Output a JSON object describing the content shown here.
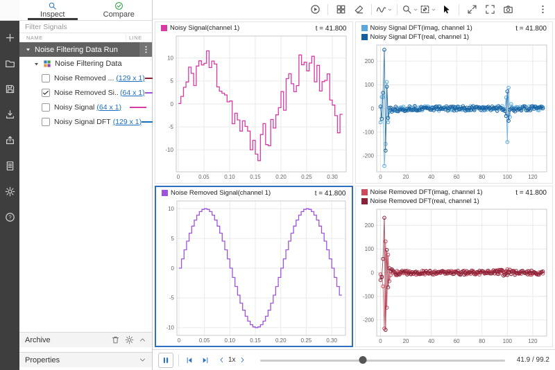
{
  "sidebar": {
    "tabs": [
      {
        "label": "Inspect"
      },
      {
        "label": "Compare"
      }
    ],
    "filter_placeholder": "Filter Signals",
    "columns": {
      "name": "NAME",
      "line": "LINE"
    },
    "run_title": "Noise Filtering Data Run",
    "group_title": "Noise Filtering Data",
    "signals": [
      {
        "name": "Noise Removed ...",
        "dims": "(129 x 1)",
        "checked": false,
        "color": "#8a2136"
      },
      {
        "name": "Noise Removed Si...",
        "dims": "(64 x 1)",
        "checked": true,
        "color": "#9d53dd"
      },
      {
        "name": "Noisy Signal ",
        "dims": "(64 x 1)",
        "checked": false,
        "color": "#d93aa2"
      },
      {
        "name": "Noisy Signal DFT ",
        "dims": "(129 x 1)",
        "checked": false,
        "color": "#1a70b8"
      }
    ],
    "archive_label": "Archive",
    "properties_label": "Properties"
  },
  "left_toolbar": {
    "items": [
      {
        "icon": "plus",
        "name": "add-button"
      },
      {
        "icon": "folder",
        "name": "open-button"
      },
      {
        "icon": "save",
        "name": "save-button"
      },
      {
        "icon": "import",
        "name": "import-button"
      },
      {
        "icon": "export",
        "name": "export-button"
      },
      {
        "icon": "report",
        "name": "report-button"
      },
      {
        "icon": "gear",
        "name": "preferences-button"
      },
      {
        "icon": "help",
        "name": "help-button"
      }
    ]
  },
  "toolbar": {
    "items": [
      {
        "icon": "run-circle",
        "name": "step-run-button"
      },
      {
        "sep": true
      },
      {
        "icon": "grid",
        "name": "subplot-layout-button"
      },
      {
        "icon": "eraser",
        "name": "clear-plots-button"
      },
      {
        "sep": true
      },
      {
        "icon": "wave",
        "name": "signal-style-button",
        "caret": true
      },
      {
        "sep": true
      },
      {
        "icon": "zoom",
        "name": "zoom-button",
        "caret": true
      },
      {
        "icon": "fit",
        "name": "fit-to-view-button",
        "caret": true
      },
      {
        "icon": "pointer",
        "name": "pointer-button",
        "active": true
      },
      {
        "sep": true
      },
      {
        "icon": "expand",
        "name": "expand-button"
      },
      {
        "icon": "fullscreen",
        "name": "fullscreen-button"
      },
      {
        "icon": "camera",
        "name": "snapshot-button"
      },
      {
        "space": true
      },
      {
        "icon": "kebab",
        "name": "more-menu-button"
      }
    ]
  },
  "charts": [
    {
      "id": "noisy-signal",
      "selected": false,
      "type": "stairs",
      "time_label": "t = 41.800",
      "legend": [
        {
          "label": "Noisy Signal(channel 1)",
          "color": "#d93aa2"
        }
      ],
      "axes": {
        "xlim": [
          -0.004,
          0.327
        ],
        "ylim": [
          -14.8,
          14.8
        ],
        "x_ticks": [
          {
            "v": 0,
            "label": "0"
          },
          {
            "v": 0.05,
            "label": "0.05"
          },
          {
            "v": 0.1,
            "label": "0.10"
          },
          {
            "v": 0.15,
            "label": "0.15"
          },
          {
            "v": 0.2,
            "label": "0.20"
          },
          {
            "v": 0.25,
            "label": "0.25"
          },
          {
            "v": 0.3,
            "label": "0.30"
          }
        ],
        "y_ticks": [
          {
            "v": 10,
            "label": "10"
          },
          {
            "v": 5,
            "label": "5"
          },
          {
            "v": 0,
            "label": "0"
          },
          {
            "v": -5,
            "label": "-5"
          },
          {
            "v": -10,
            "label": "-10"
          }
        ]
      },
      "series": [
        {
          "color": "#d93aa2",
          "gen": {
            "kind": "sine_stairs",
            "n": 64,
            "dt": 0.005,
            "freq": 5,
            "amp": 9,
            "noise": 3.9,
            "seed": 11
          }
        }
      ]
    },
    {
      "id": "noisy-dft",
      "selected": false,
      "type": "linemarkers",
      "time_label": "t = 41.800",
      "legend": [
        {
          "label": "Noisy Signal DFT(imag, channel 1)",
          "color": "#5ba7dd"
        },
        {
          "label": "Noisy Signal DFT(real, channel 1)",
          "color": "#145f9e"
        }
      ],
      "axes": {
        "xlim": [
          -3,
          131
        ],
        "ylim": [
          -268,
          268
        ],
        "x_ticks": [
          {
            "v": 0,
            "label": "0"
          },
          {
            "v": 20,
            "label": "20"
          },
          {
            "v": 40,
            "label": "40"
          },
          {
            "v": 60,
            "label": "60"
          },
          {
            "v": 80,
            "label": "80"
          },
          {
            "v": 100,
            "label": "100"
          },
          {
            "v": 120,
            "label": "120"
          }
        ],
        "y_ticks": [
          {
            "v": 200,
            "label": "200"
          },
          {
            "v": 100,
            "label": "100"
          },
          {
            "v": 0,
            "label": "0"
          },
          {
            "v": -100,
            "label": "-100"
          },
          {
            "v": -200,
            "label": "-200"
          }
        ]
      },
      "series": [
        {
          "color": "#5ba7dd",
          "gen": {
            "kind": "dft",
            "n": 129,
            "seed": 7,
            "noise": 10,
            "decay": 5,
            "bump": 16,
            "bump_k": 100,
            "spikes": {
              "2": 48,
              "3": -243,
              "4": -150,
              "5": 112,
              "6": -58,
              "99": 46,
              "100": -142,
              "101": 88,
              "102": -36
            }
          }
        },
        {
          "color": "#145f9e",
          "gen": {
            "kind": "dft",
            "n": 129,
            "seed": 13,
            "noise": 10,
            "decay": 5,
            "bump": 14,
            "bump_k": 100,
            "spikes": {
              "2": 66,
              "3": 248,
              "4": -178,
              "5": 92,
              "6": -40,
              "99": -32,
              "100": 72,
              "101": -52
            }
          }
        }
      ]
    },
    {
      "id": "noise-removed-signal",
      "selected": true,
      "type": "stairs",
      "time_label": "t = 41.800",
      "legend": [
        {
          "label": "Noise Removed Signal(channel 1)",
          "color": "#9d53dd"
        }
      ],
      "axes": {
        "xlim": [
          -0.004,
          0.327
        ],
        "ylim": [
          -11.3,
          11.3
        ],
        "x_ticks": [
          {
            "v": 0,
            "label": "0"
          },
          {
            "v": 0.05,
            "label": "0.05"
          },
          {
            "v": 0.1,
            "label": "0.10"
          },
          {
            "v": 0.15,
            "label": "0.15"
          },
          {
            "v": 0.2,
            "label": "0.20"
          },
          {
            "v": 0.25,
            "label": "0.25"
          },
          {
            "v": 0.3,
            "label": "0.30"
          }
        ],
        "y_ticks": [
          {
            "v": 10,
            "label": "10"
          },
          {
            "v": 5,
            "label": "5"
          },
          {
            "v": 0,
            "label": "0"
          },
          {
            "v": -5,
            "label": "-5"
          },
          {
            "v": -10,
            "label": "-10"
          }
        ]
      },
      "series": [
        {
          "color": "#9d53dd",
          "gen": {
            "kind": "sine_stairs",
            "n": 64,
            "dt": 0.005,
            "freq": 5,
            "amp": 10,
            "noise": 0,
            "seed": 1
          }
        }
      ]
    },
    {
      "id": "noise-removed-dft",
      "selected": false,
      "type": "linemarkers",
      "time_label": "t = 41.800",
      "legend": [
        {
          "label": "Noise Removed DFT(imag, channel 1)",
          "color": "#ce4a5c"
        },
        {
          "label": "Noise Removed DFT(real, channel 1)",
          "color": "#8a2136"
        }
      ],
      "axes": {
        "xlim": [
          -3,
          131
        ],
        "ylim": [
          -268,
          268
        ],
        "x_ticks": [
          {
            "v": 0,
            "label": "0"
          },
          {
            "v": 20,
            "label": "20"
          },
          {
            "v": 40,
            "label": "40"
          },
          {
            "v": 60,
            "label": "60"
          },
          {
            "v": 80,
            "label": "80"
          },
          {
            "v": 100,
            "label": "100"
          },
          {
            "v": 120,
            "label": "120"
          }
        ],
        "y_ticks": [
          {
            "v": 200,
            "label": "200"
          },
          {
            "v": 100,
            "label": "100"
          },
          {
            "v": 0,
            "label": "0"
          },
          {
            "v": -100,
            "label": "-100"
          },
          {
            "v": -200,
            "label": "-200"
          }
        ]
      },
      "series": [
        {
          "color": "#ce4a5c",
          "gen": {
            "kind": "dft",
            "n": 129,
            "seed": 21,
            "noise": 9,
            "decay": 5,
            "bump": 15,
            "bump_k": 97,
            "spikes": {
              "2": -58,
              "3": -236,
              "4": 132,
              "5": -148,
              "6": 76,
              "7": -36
            }
          }
        },
        {
          "color": "#8a2136",
          "gen": {
            "kind": "dft",
            "n": 129,
            "seed": 29,
            "noise": 9,
            "decay": 5,
            "bump": 13,
            "bump_k": 97,
            "spikes": {
              "2": 58,
              "3": 232,
              "4": -242,
              "5": 96,
              "6": -62
            }
          }
        }
      ]
    }
  ],
  "playback": {
    "speed": "1x",
    "position_label": "41.9 / 99.2",
    "progress": 0.42
  }
}
